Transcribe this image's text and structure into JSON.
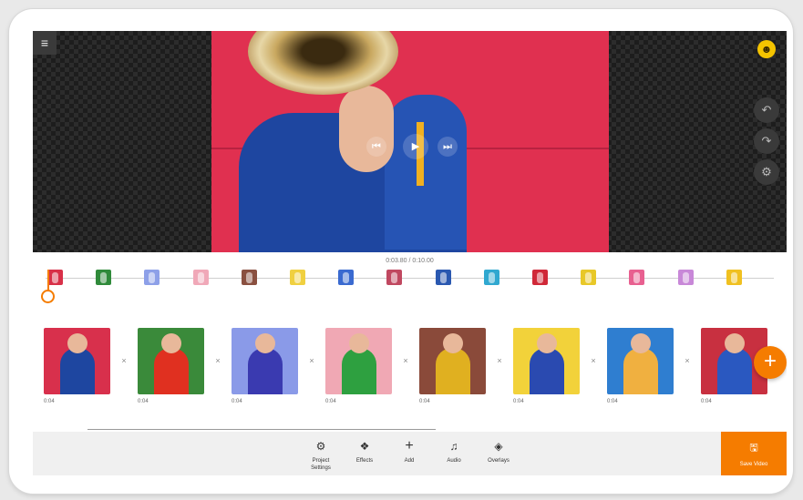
{
  "header": {
    "menu_icon": "hamburger-icon",
    "account_icon": "emoji-avatar-icon"
  },
  "player": {
    "time_display": "0:03.80 / 0:10.00",
    "controls": [
      "skip-back-icon",
      "play-icon",
      "skip-forward-icon"
    ],
    "side_buttons": [
      "undo-icon",
      "redo-icon",
      "settings-icon"
    ]
  },
  "storyboard": {
    "mini_thumbs": [
      {
        "color": "#d83048"
      },
      {
        "color": "#2f8a3a"
      },
      {
        "color": "#8da0e8"
      },
      {
        "color": "#f0a8b8"
      },
      {
        "color": "#8a5040"
      },
      {
        "color": "#f0d040"
      },
      {
        "color": "#3a6ad0"
      },
      {
        "color": "#c04860"
      },
      {
        "color": "#2a58b0"
      },
      {
        "color": "#30a8d0"
      },
      {
        "color": "#d02838"
      },
      {
        "color": "#e8c828"
      },
      {
        "color": "#e86090"
      },
      {
        "color": "#c888d8"
      },
      {
        "color": "#f0c020"
      }
    ],
    "clips": [
      {
        "duration": "0:04",
        "bg": "#d8304c",
        "fg": "#1e46a0"
      },
      {
        "duration": "0:04",
        "bg": "#3a8a3a",
        "fg": "#e03020"
      },
      {
        "duration": "0:04",
        "bg": "#8a9ae8",
        "fg": "#3a3ab0"
      },
      {
        "duration": "0:04",
        "bg": "#f0a8b4",
        "fg": "#2ea040"
      },
      {
        "duration": "0:04",
        "bg": "#8a4a3a",
        "fg": "#e0b020"
      },
      {
        "duration": "0:04",
        "bg": "#f2d23a",
        "fg": "#2a4ab0"
      },
      {
        "duration": "0:04",
        "bg": "#2f7ed0",
        "fg": "#f0b040"
      },
      {
        "duration": "0:04",
        "bg": "#c83040",
        "fg": "#2a58c0"
      }
    ],
    "separator_icon": "close-icon",
    "add_icon": "plus-icon"
  },
  "toolbar": {
    "items": [
      {
        "label": "Project\nSettings",
        "icon": "gear-icon",
        "glyph": "⚙"
      },
      {
        "label": "Effects",
        "icon": "effects-icon",
        "glyph": "❖"
      },
      {
        "label": "Add",
        "icon": "plus-icon",
        "glyph": "+"
      },
      {
        "label": "Audio",
        "icon": "music-icon",
        "glyph": "♫"
      },
      {
        "label": "Overlays",
        "icon": "layers-icon",
        "glyph": "◈"
      }
    ],
    "save_label": "Save Video",
    "save_icon": "save-icon"
  },
  "colors": {
    "accent": "#f57c00",
    "toolbar_bg": "#f0f0f0",
    "preview_bg": "#1d1d1d"
  }
}
